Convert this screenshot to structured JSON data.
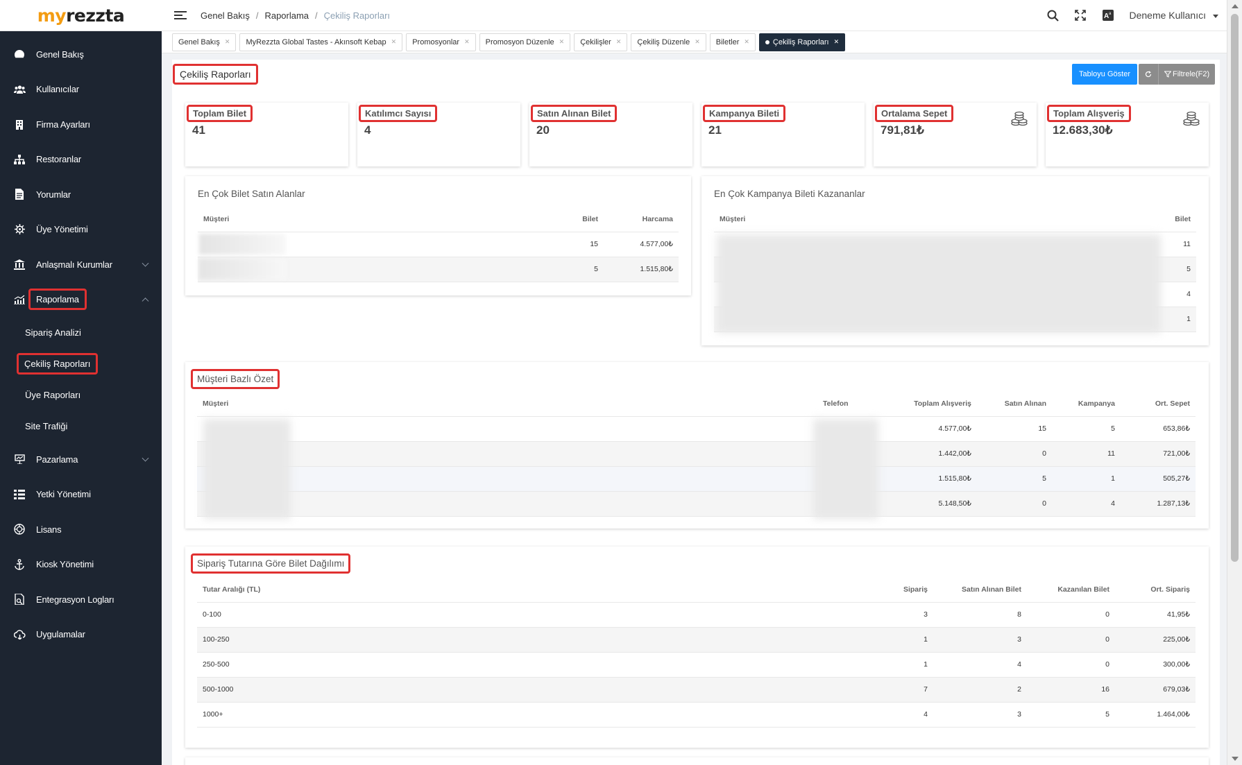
{
  "logo": {
    "prefix": "my",
    "rest": "rezzta"
  },
  "sidebar": {
    "items": [
      {
        "label": "Genel Bakış",
        "icon": "dashboard-icon"
      },
      {
        "label": "Kullanıcılar",
        "icon": "users-icon"
      },
      {
        "label": "Firma Ayarları",
        "icon": "building-icon"
      },
      {
        "label": "Restoranlar",
        "icon": "sitemap-icon"
      },
      {
        "label": "Yorumlar",
        "icon": "file-icon"
      },
      {
        "label": "Üye Yönetimi",
        "icon": "gear-icon"
      },
      {
        "label": "Anlaşmalı Kurumlar",
        "icon": "bank-icon"
      },
      {
        "label": "Raporlama",
        "icon": "chart-icon"
      },
      {
        "label": "Pazarlama",
        "icon": "presentation-icon"
      },
      {
        "label": "Yetki Yönetimi",
        "icon": "list-icon"
      },
      {
        "label": "Lisans",
        "icon": "license-icon"
      },
      {
        "label": "Kiosk Yönetimi",
        "icon": "anchor-icon"
      },
      {
        "label": "Entegrasyon Logları",
        "icon": "log-icon"
      },
      {
        "label": "Uygulamalar",
        "icon": "cloud-icon"
      }
    ],
    "sub_items": [
      "Sipariş Analizi",
      "Çekiliş Raporları",
      "Üye Raporları",
      "Site Trafiği"
    ]
  },
  "breadcrumb": [
    "Genel Bakış",
    "Raporlama",
    "Çekiliş Raporları"
  ],
  "user": {
    "name": "Deneme Kullanıcı"
  },
  "tabs": [
    "Genel Bakış",
    "MyRezzta Global Tastes - Akınsoft Kebap",
    "Promosyonlar",
    "Promosyon Düzenle",
    "Çekilişler",
    "Çekiliş Düzenle",
    "Biletler",
    "Çekiliş Raporları"
  ],
  "page": {
    "title": "Çekiliş Raporları",
    "show_table_button": "Tabloyu Göster",
    "filter_button": "Filtrele(F2)"
  },
  "stats": [
    {
      "label": "Toplam Bilet",
      "value": "41"
    },
    {
      "label": "Katılımcı Sayısı",
      "value": "4"
    },
    {
      "label": "Satın Alınan Bilet",
      "value": "20"
    },
    {
      "label": "Kampanya Bileti",
      "value": "21"
    },
    {
      "label": "Ortalama Sepet",
      "value": "791,81₺"
    },
    {
      "label": "Toplam Alışveriş",
      "value": "12.683,30₺"
    }
  ],
  "top_buyers": {
    "title": "En Çok Bilet Satın Alanlar",
    "headers": [
      "Müşteri",
      "Bilet",
      "Harcama"
    ],
    "rows": [
      {
        "bilet": "15",
        "harcama": "4.577,00₺"
      },
      {
        "bilet": "5",
        "harcama": "1.515,80₺"
      }
    ]
  },
  "top_winners": {
    "title": "En Çok Kampanya Bileti Kazananlar",
    "headers": [
      "Müşteri",
      "Bilet"
    ],
    "rows": [
      {
        "bilet": "11"
      },
      {
        "bilet": "5"
      },
      {
        "bilet": "4"
      },
      {
        "bilet": "1"
      }
    ]
  },
  "customer_summary": {
    "title": "Müşteri Bazlı Özet",
    "headers": [
      "Müşteri",
      "Telefon",
      "Toplam Alışveriş",
      "Satın Alınan",
      "Kampanya",
      "Ort. Sepet"
    ],
    "rows": [
      {
        "toplam": "4.577,00₺",
        "satin": "15",
        "kampanya": "5",
        "ort": "653,86₺"
      },
      {
        "toplam": "1.442,00₺",
        "satin": "0",
        "kampanya": "11",
        "ort": "721,00₺"
      },
      {
        "toplam": "1.515,80₺",
        "satin": "5",
        "kampanya": "1",
        "ort": "505,27₺"
      },
      {
        "toplam": "5.148,50₺",
        "satin": "0",
        "kampanya": "4",
        "ort": "1.287,13₺"
      }
    ]
  },
  "distribution": {
    "title": "Sipariş Tutarına Göre Bilet Dağılımı",
    "headers": [
      "Tutar Aralığı (TL)",
      "Sipariş",
      "Satın Alınan Bilet",
      "Kazanılan Bilet",
      "Ort. Sipariş"
    ],
    "rows": [
      {
        "range": "0-100",
        "siparis": "3",
        "satin": "8",
        "kazanilan": "0",
        "ort": "41,95₺"
      },
      {
        "range": "100-250",
        "siparis": "1",
        "satin": "3",
        "kazanilan": "0",
        "ort": "225,00₺"
      },
      {
        "range": "250-500",
        "siparis": "1",
        "satin": "4",
        "kazanilan": "0",
        "ort": "300,00₺"
      },
      {
        "range": "500-1000",
        "siparis": "7",
        "satin": "2",
        "kazanilan": "16",
        "ort": "679,03₺"
      },
      {
        "range": "1000+",
        "siparis": "4",
        "satin": "3",
        "kazanilan": "5",
        "ort": "1.464,00₺"
      }
    ]
  }
}
